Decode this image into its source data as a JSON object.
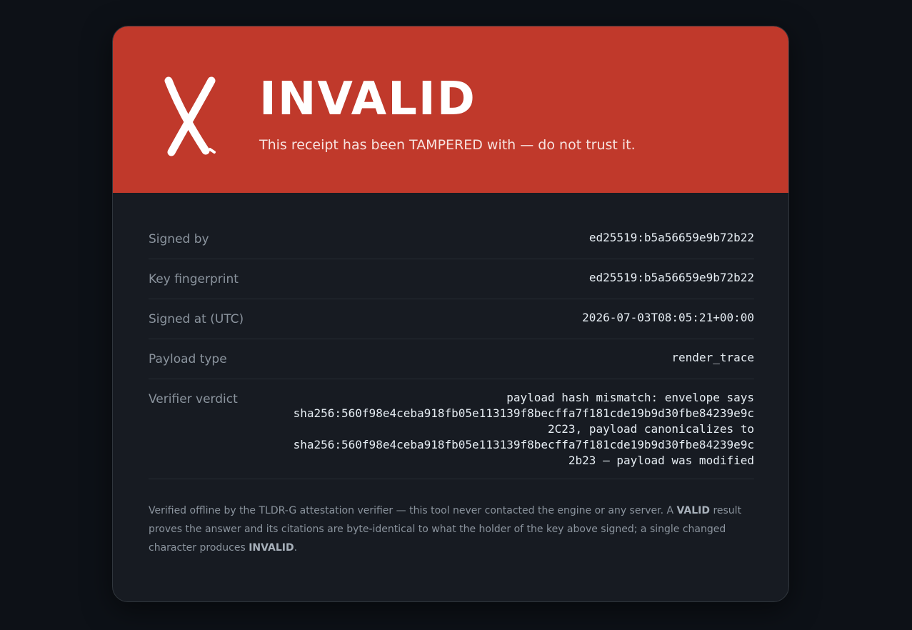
{
  "banner": {
    "title": "INVALID",
    "subtitle": "This receipt has been TAMPERED with — do not trust it.",
    "icon": "x-mark-icon",
    "color": "#c0392b"
  },
  "details": [
    {
      "label": "Signed by",
      "value": "ed25519:b5a56659e9b72b22"
    },
    {
      "label": "Key fingerprint",
      "value": "ed25519:b5a56659e9b72b22"
    },
    {
      "label": "Signed at (UTC)",
      "value": "2026-07-03T08:05:21+00:00"
    },
    {
      "label": "Payload type",
      "value": "render_trace"
    },
    {
      "label": "Verifier verdict",
      "value": "payload hash mismatch: envelope says\nsha256:560f98e4ceba918fb05e113139f8becffa7f181cde19b9d30fbe84239e9c\n2C23, payload canonicalizes to\nsha256:560f98e4ceba918fb05e113139f8becffa7f181cde19b9d30fbe84239e9c\n2b23 — payload was modified"
    }
  ],
  "footer": {
    "part1": "Verified offline by the TLDR-G attestation verifier — this tool never contacted the engine or any server. A ",
    "valid_word": "VALID",
    "part2": " result proves the answer and its citations are byte-identical to what the holder of the key above signed; a single changed character produces ",
    "invalid_word": "INVALID",
    "part3": "."
  }
}
